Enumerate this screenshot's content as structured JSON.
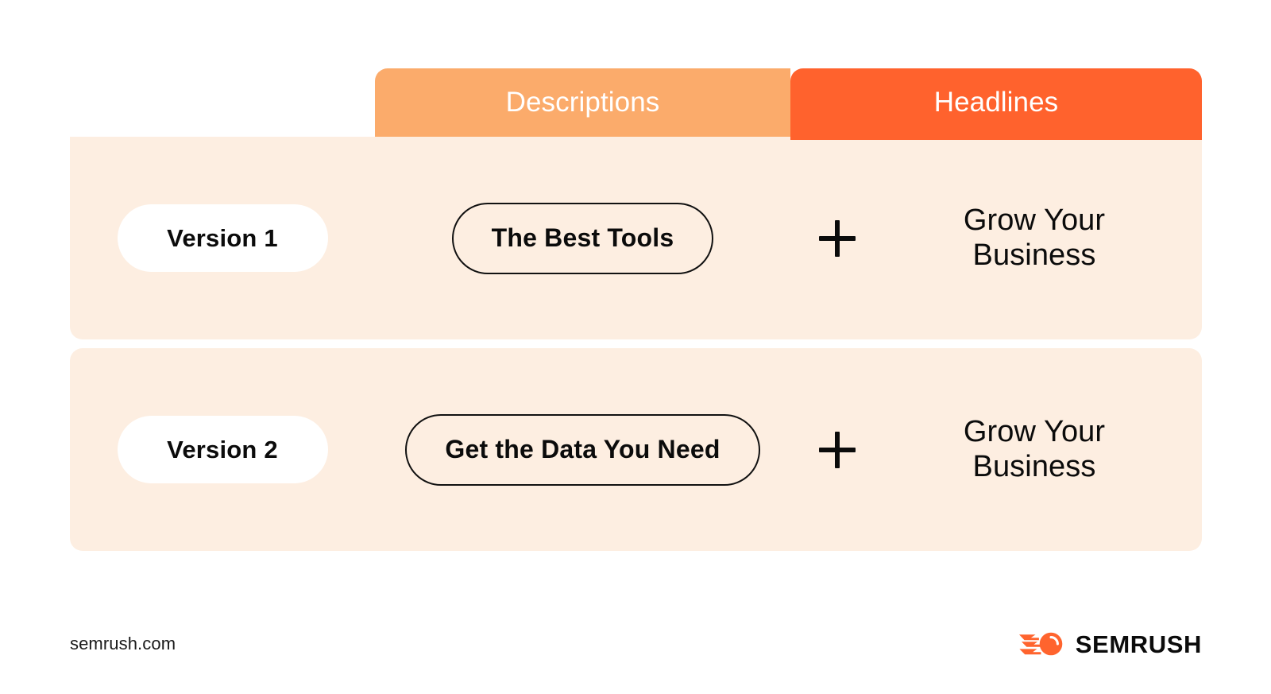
{
  "header": {
    "tabs": [
      {
        "label": "Descriptions",
        "color": "#FBAB6B"
      },
      {
        "label": "Headlines",
        "color": "#FF622D"
      }
    ]
  },
  "rows": [
    {
      "version_label": "Version 1",
      "description": "The Best Tools",
      "combiner": "+",
      "headline": "Grow Your Business"
    },
    {
      "version_label": "Version 2",
      "description": "Get the Data You Need",
      "combiner": "+",
      "headline": "Grow Your Business"
    }
  ],
  "footer": {
    "url": "semrush.com",
    "brand_name": "SEMRUSH",
    "brand_icon": "semrush-comet-icon"
  },
  "colors": {
    "tab_light": "#FBAB6B",
    "tab_dark": "#FF622D",
    "panel_bg": "#FDEEE1",
    "pill_bg": "#FFFFFF",
    "text": "#0B0B0B",
    "page_bg": "#FFFFFF",
    "brand_orange": "#FF642E"
  }
}
